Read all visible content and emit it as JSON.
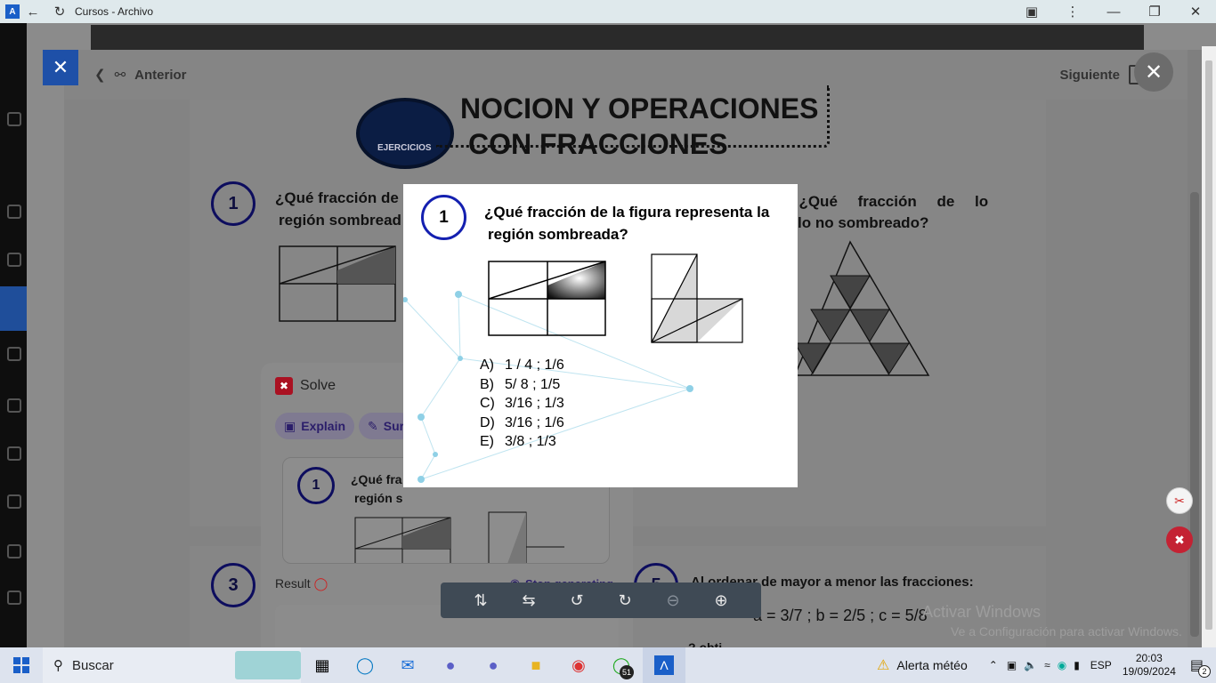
{
  "window": {
    "title": "Cursos - Archivo",
    "app_icon": "A"
  },
  "viewer": {
    "prev_label": "Anterior",
    "next_label": "Siguiente"
  },
  "document": {
    "title_line1": "NOCION Y OPERACIONES",
    "title_line2": "CON FRACCIONES",
    "logo_label": "EJERCICIOS",
    "q1_number": "1",
    "q1_text_line1": "¿Qué fracción de",
    "q1_text_line2": "región sombread",
    "q2_text_line1": ", ¿Qué fracción de lo",
    "q2_text_line2": "lo no sombreado?",
    "q3_number": "3",
    "q5_number": "5",
    "q5_text": "Al ordenar de mayor a menor las fracciones:",
    "q5_fractions": "a = 3/7  ; b = 2/5 ; c = 5/8",
    "q5_cut": "? obti"
  },
  "solve_panel": {
    "title": "Solve",
    "explain_label": "Explain",
    "summarize_label": "Sur",
    "card_number": "1",
    "card_text_line1": "¿Qué fra",
    "card_text_line2": "región s",
    "result_label": "Result",
    "stop_label": "Stop generating"
  },
  "popup": {
    "number": "1",
    "question_line1": "¿Qué fracción de la figura representa la",
    "question_line2": "región sombreada?",
    "options": [
      {
        "letter": "A)",
        "text": "1 / 4 ; 1/6"
      },
      {
        "letter": "B)",
        "text": "5/ 8 ; 1/5"
      },
      {
        "letter": "C)",
        "text": "3/16 ; 1/3"
      },
      {
        "letter": "D)",
        "text": "3/16 ; 1/6"
      },
      {
        "letter": "E)",
        "text": "3/8 ; 1/3"
      }
    ]
  },
  "watermark": {
    "line1": "Activar Windows",
    "line2": "Ve a Configuración para activar Windows."
  },
  "taskbar": {
    "search_placeholder": "Buscar",
    "whatsapp_badge": "51",
    "weather": "Alerta météo",
    "language": "ESP",
    "time": "20:03",
    "date": "19/09/2024",
    "notifications": "2"
  },
  "colors": {
    "popup_circle": "#1420b0",
    "solve_brand": "#cc1f2d",
    "titlebar_bg": "#dfe9ec",
    "taskbar_bg": "#dde3ee",
    "blue_close": "#1e50a8"
  }
}
